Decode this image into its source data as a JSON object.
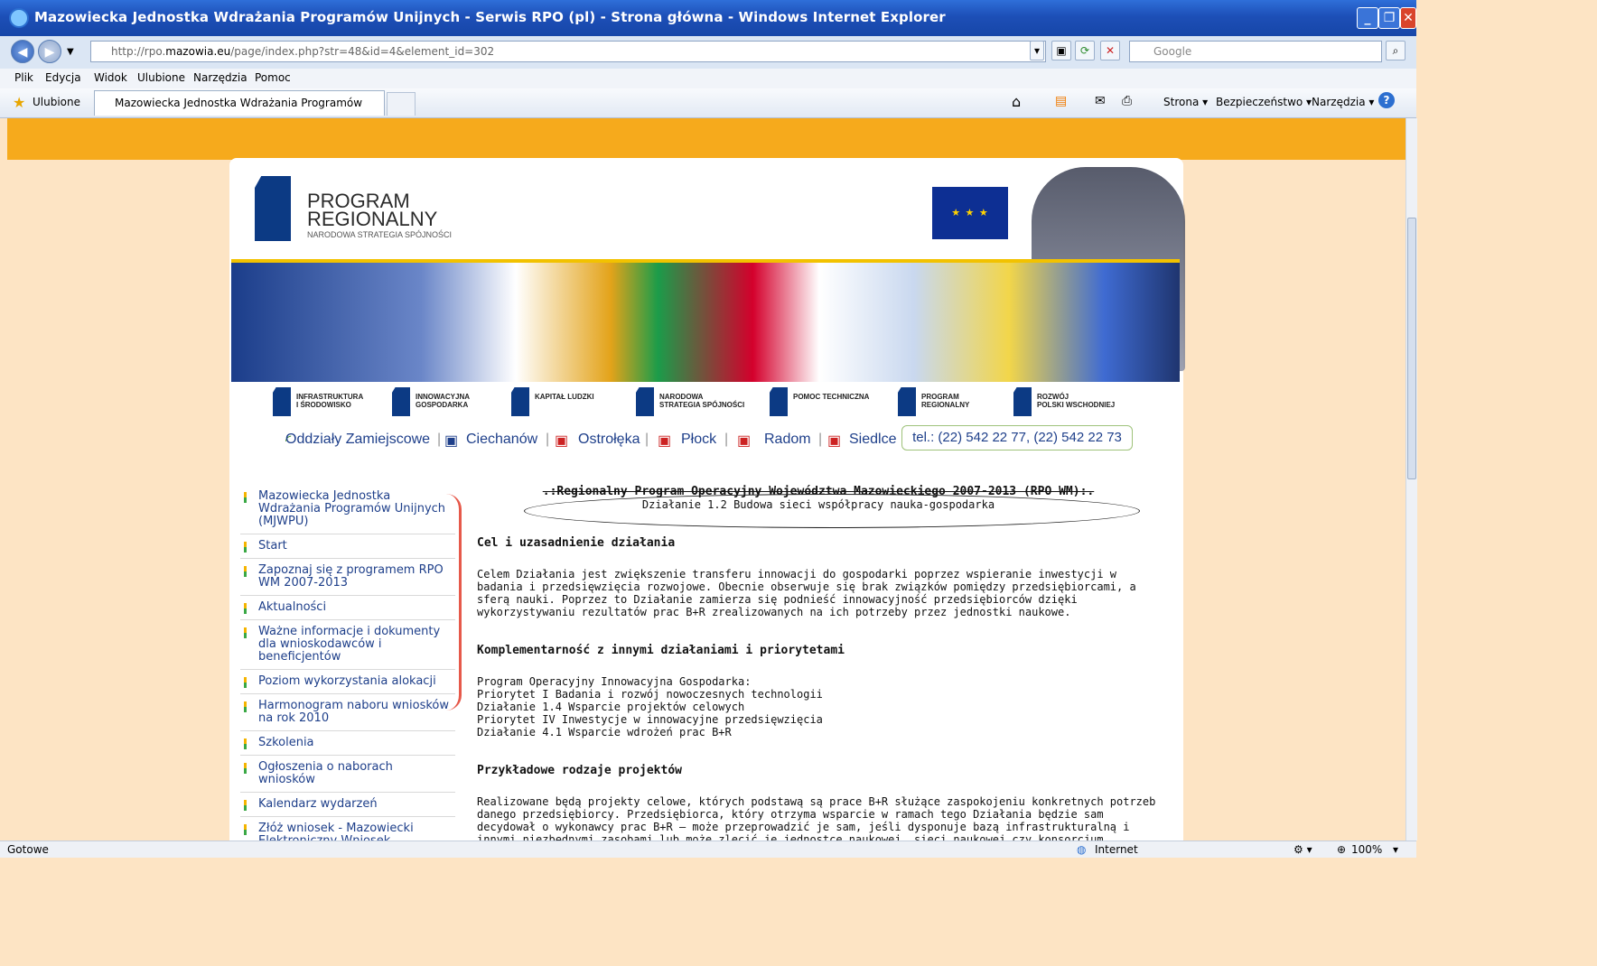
{
  "window": {
    "title": "Mazowiecka Jednostka Wdrażania Programów Unijnych - Serwis RPO (pl) - Strona główna - Windows Internet Explorer",
    "url_prefix": "http://rpo.",
    "url_host": "mazowia.eu",
    "url_path": "/page/index.php?str=48&id=4&element_id=302",
    "search_placeholder": "Google"
  },
  "menu": [
    "Plik",
    "Edycja",
    "Widok",
    "Ulubione",
    "Narzędzia",
    "Pomoc"
  ],
  "favbar": {
    "favorites": "Ulubione",
    "tab_title": "Mazowiecka Jednostka Wdrażania Programów Unijnyc...",
    "commands": [
      "Strona ▾",
      "Bezpieczeństwo ▾",
      "Narzędzia ▾"
    ]
  },
  "header": {
    "logo_line1": "PROGRAM",
    "logo_line2": "REGIONALNY",
    "logo_sub": "NARODOWA STRATEGIA SPÓJNOŚCI",
    "eu_stars": "★ ★ ★"
  },
  "programs": [
    {
      "line1": "INFRASTRUKTURA",
      "line2": "I ŚRODOWISKO"
    },
    {
      "line1": "INNOWACYJNA",
      "line2": "GOSPODARKA"
    },
    {
      "line1": "KAPITAŁ LUDZKI",
      "line2": ""
    },
    {
      "line1": "NARODOWA",
      "line2": "STRATEGIA SPÓJNOŚCI"
    },
    {
      "line1": "POMOC TECHNICZNA",
      "line2": ""
    },
    {
      "line1": "PROGRAM",
      "line2": "REGIONALNY"
    },
    {
      "line1": "ROZWÓJ",
      "line2": "POLSKI WSCHODNIEJ"
    }
  ],
  "branches": {
    "label": "Oddziały Zamiejscowe",
    "items": [
      "Ciechanów",
      "Ostrołęka",
      "Płock",
      "Radom",
      "Siedlce"
    ],
    "tel": "tel.: (22) 542 22 77, (22) 542 22 73"
  },
  "sidebar": [
    "Mazowiecka Jednostka Wdrażania Programów Unijnych (MJWPU)",
    "Start",
    "Zapoznaj się z programem RPO WM 2007-2013",
    "Aktualności",
    "Ważne informacje i dokumenty dla wnioskodawców i beneficjentów",
    "Poziom wykorzystania alokacji",
    "Harmonogram naboru wniosków na rok 2010",
    "Szkolenia",
    "Ogłoszenia o naborach wniosków",
    "Kalendarz wydarzeń",
    "Złóż wniosek - Mazowiecki Elektroniczny Wniosek"
  ],
  "main": {
    "heading1": ".:Regionalny Program Operacyjny Województwa Mazowieckiego 2007-2013 (RPO WM):.",
    "heading2": "Działanie 1.2 Budowa sieci współpracy nauka-gospodarka",
    "section1_title": "Cel i uzasadnienie działania",
    "section1_text": "Celem Działania jest zwiększenie transferu innowacji do gospodarki poprzez wspieranie inwestycji w badania i przedsięwzięcia rozwojowe. Obecnie obserwuje się brak związków pomiędzy przedsiębiorcami, a sferą nauki. Poprzez to Działanie zamierza się podnieść innowacyjność przedsiębiorców dzięki wykorzystywaniu rezultatów prac B+R zrealizowanych na ich potrzeby przez jednostki naukowe.",
    "section2_title": "Komplementarność z innymi działaniami i priorytetami",
    "section2_lines": [
      "Program Operacyjny Innowacyjna Gospodarka:",
      "Priorytet I Badania i rozwój nowoczesnych technologii",
      "Działanie 1.4 Wsparcie projektów celowych",
      "Priorytet IV Inwestycje w innowacyjne przedsięwzięcia",
      "Działanie 4.1 Wsparcie wdrożeń prac B+R"
    ],
    "section3_title": "Przykładowe rodzaje projektów",
    "section3_text": "Realizowane będą projekty celowe, których podstawą są prace B+R służące zaspokojeniu konkretnych potrzeb danego przedsiębiorcy. Przedsiębiorca, który otrzyma wsparcie w ramach tego Działania będzie sam decydował o wykonawcy prac B+R – może przeprowadzić je sam, jeśli dysponuje bazą infrastrukturalną i innymi niezbędnymi zasobami lub może zlecić je jednostce naukowej, sieci naukowej czy konsorcjum naukowo-przemysłowemu lub spółce powołanej z udziałem"
  },
  "status": {
    "left": "Gotowe",
    "zone": "Internet",
    "zoom": "100%"
  }
}
